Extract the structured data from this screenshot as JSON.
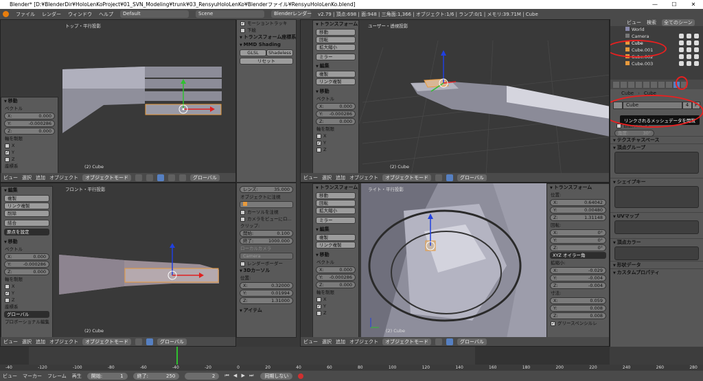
{
  "window": {
    "title": "Blender* [D:¥BlenderDir¥HoloLenKoProject¥01_SVN_Modeling¥trunk¥03_RensyuHoloLenKo¥Blenderファイル¥RensyuHoloLenKo.blend]",
    "min": "—",
    "max": "☐",
    "close": "✕"
  },
  "menubar": {
    "items": [
      "ファイル",
      "レンダー",
      "ウィンドウ",
      "ヘルプ"
    ],
    "layout": "Default",
    "scene": "Scene",
    "engine": "Blenderレンダー",
    "info": "v2.79 | 頂点:698 | 面:948 | 三角面:1,366 | オブジェクト:1/6 | ランプ:0/1 | メモリ:39.71M | Cube"
  },
  "viewports": {
    "top_left": {
      "label": "トップ・平行投影",
      "obj": "(2) Cube"
    },
    "top_right": {
      "label": "ユーザー・透視投影",
      "obj": "(2) Cube"
    },
    "bottom_left": {
      "label": "フロント・平行投影",
      "obj": "(2) Cube"
    },
    "bottom_right": {
      "label": "ライト・平行投影",
      "obj": "(2) Cube"
    }
  },
  "vheader": {
    "view": "ビュー",
    "select": "選択",
    "add": "追加",
    "object": "オブジェクト",
    "mode": "オブジェクトモード",
    "orient": "グローバル"
  },
  "tool_tl": {
    "move": "移動",
    "vector": "ベクトル",
    "x": "X:",
    "xv": "0.000",
    "y": "Y:",
    "yv": "-0.000286",
    "z": "Z:",
    "zv": "0.000",
    "constraint": "軸を制限",
    "cx": "X",
    "cy": "Y",
    "cz": "Z",
    "coord": "座標系"
  },
  "tool_tr": {
    "transform": "トランスフォーム",
    "move": "移動",
    "rotate": "回転",
    "scale": "拡大縮小",
    "mirror": "ミラー",
    "edit": "編集",
    "dup": "複製",
    "linkdup": "リンク複製",
    "move2": "移動",
    "vector": "ベクトル",
    "x": "X:",
    "xv": "0.000",
    "y": "Y:",
    "yv": "-0.000286",
    "z": "Z:",
    "zv": "0.000",
    "constraint": "軸を制限",
    "cx": "X",
    "cy": "Y",
    "cz": "Z"
  },
  "tool_bl": {
    "edit": "編集",
    "dup": "複製",
    "linkdup": "リンク複製",
    "del": "削除",
    "join": "結合",
    "origin": "原点を設定",
    "move": "移動",
    "vector": "ベクトル",
    "x": "X:",
    "xv": "0.000",
    "y": "Y:",
    "yv": "-0.000286",
    "z": "Z:",
    "zv": "0.000",
    "constraint": "軸を制限",
    "cx": "X",
    "cy": "Y",
    "cz": "Z",
    "coord": "座標系",
    "global": "グローバル",
    "prop": "プロポーショナル編集"
  },
  "tool_br": {
    "transform": "トランスフォーム",
    "move": "移動",
    "rotate": "回転",
    "scale": "拡大縮小",
    "mirror": "ミラー",
    "edit": "編集",
    "dup": "複製",
    "linkdup": "リンク複製",
    "move2": "移動",
    "vector": "ベクトル",
    "x": "X:",
    "xv": "0.000",
    "y": "Y:",
    "yv": "-0.000286",
    "z": "Z:",
    "zv": "0.000",
    "constraint": "軸を制限",
    "cx": "X",
    "cy": "Y",
    "cz": "Z"
  },
  "np_top": {
    "motion": "モーショントラッキ",
    "bottom": "下絵",
    "orient": "トランスフォーム座標系",
    "mmd": "MMD Shading",
    "glsl": "GLSL",
    "shadeless": "Shadeless",
    "reset": "リセット"
  },
  "np_bottom": {
    "lens": "レンズ:",
    "lensv": "35.000",
    "lockobj": "オブジェクトに注視",
    "lockcursor": "カーソルを注視",
    "cam2view": "カメラをビューにロ...",
    "clip": "クリップ:",
    "start": "開始:",
    "startv": "0.100",
    "end": "終了:",
    "endv": "1000.000",
    "localcam": "ローカルカメラ",
    "camera": "Camera",
    "renderborder": "レンダーボーダー",
    "cursor3d": "3Dカーソル",
    "pos": "位置:",
    "x": "X:",
    "xv": "0.32000",
    "y": "Y:",
    "yv": "0.01994",
    "z": "Z:",
    "zv": "1.31000",
    "item": "アイテム"
  },
  "np_right": {
    "transform": "トランスフォーム",
    "pos": "位置:",
    "px": "X:",
    "pxv": "0.64042",
    "py": "Y:",
    "pyv": "0.00480",
    "pz": "Z:",
    "pzv": "1.31148",
    "rot": "回転:",
    "rx": "X:",
    "rxv": "0°",
    "ry": "Y:",
    "ryv": "0°",
    "rz": "Z:",
    "rzv": "0°",
    "euler": "XYZ オイラー角",
    "scale": "拡縮小:",
    "sx": "X:",
    "sxv": "-0.029",
    "sy": "Y:",
    "syv": "-0.004",
    "sz": "Z:",
    "szv": "-0.004",
    "dim": "寸法:",
    "dx": "X:",
    "dxv": "0.059",
    "dy": "Y:",
    "dyv": "0.008",
    "dz": "Z:",
    "dzv": "0.008",
    "grease": "グリースペンシルレ"
  },
  "outliner": {
    "view": "ビュー",
    "search": "検索",
    "allscenes": "全てのシーン",
    "rows": [
      "World",
      "Camera",
      "Cube",
      "Cube.001",
      "Cube.002",
      "Cube.003"
    ]
  },
  "props": {
    "crumb1": "Cube",
    "crumb2": "Cube",
    "meshname": "Cube",
    "users": "4",
    "fake": "F",
    "tooltip": "リンクされるメッシュデータを閲覧",
    "sections": [
      "テクスチャスペース",
      "頂点グループ",
      "シェイプキー",
      "UVマップ",
      "頂点カラー",
      "形状データ",
      "カスタムプロパティ"
    ],
    "angle": "角度:",
    "anglev": "30°",
    "autosmooth": "自動スムーズ"
  },
  "timeline": {
    "ticks": [
      "-40",
      "-120",
      "-100",
      "-80",
      "-60",
      "-40",
      "-20",
      "0",
      "20",
      "40",
      "60",
      "80",
      "100",
      "120",
      "140",
      "160",
      "180",
      "200",
      "220",
      "240",
      "260",
      "280"
    ],
    "view": "ビュー",
    "marker": "マーカー",
    "frame": "フレーム",
    "play": "再生",
    "start": "開始:",
    "startv": "1",
    "end": "終了:",
    "endv": "250",
    "current": "2",
    "sync": "同期しない"
  },
  "colors": {
    "circle": "#e82020",
    "active": "#5680c2",
    "selected_outline": "#e89a3c"
  }
}
